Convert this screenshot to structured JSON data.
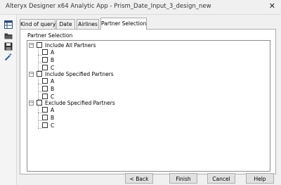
{
  "window": {
    "title": "Alteryx Designer x64  Analytic App  -  Prism_Date_Input_3_design_new",
    "close_glyph": "✕"
  },
  "tabs": [
    {
      "label": "Kind of query"
    },
    {
      "label": "Date"
    },
    {
      "label": "Airlines"
    },
    {
      "label": "Partner Selection",
      "active": true
    }
  ],
  "panel": {
    "section_label": "Partner Selection",
    "tree": [
      {
        "label": "Include All Partners",
        "expander": "−",
        "children": [
          "A",
          "B",
          "C"
        ]
      },
      {
        "label": "Include Specified Partners",
        "expander": "−",
        "children": [
          "A",
          "B",
          "C"
        ]
      },
      {
        "label": "Exclude Specified Partners",
        "expander": "−",
        "children": [
          "A",
          "B",
          "C"
        ]
      }
    ]
  },
  "buttons": {
    "back": "< Back",
    "finish": "Finish",
    "cancel": "Cancel",
    "help": "Help"
  },
  "sidebar_icons": [
    "grid-icon",
    "open-folder-icon",
    "save-icon",
    "magic-wand-icon"
  ]
}
